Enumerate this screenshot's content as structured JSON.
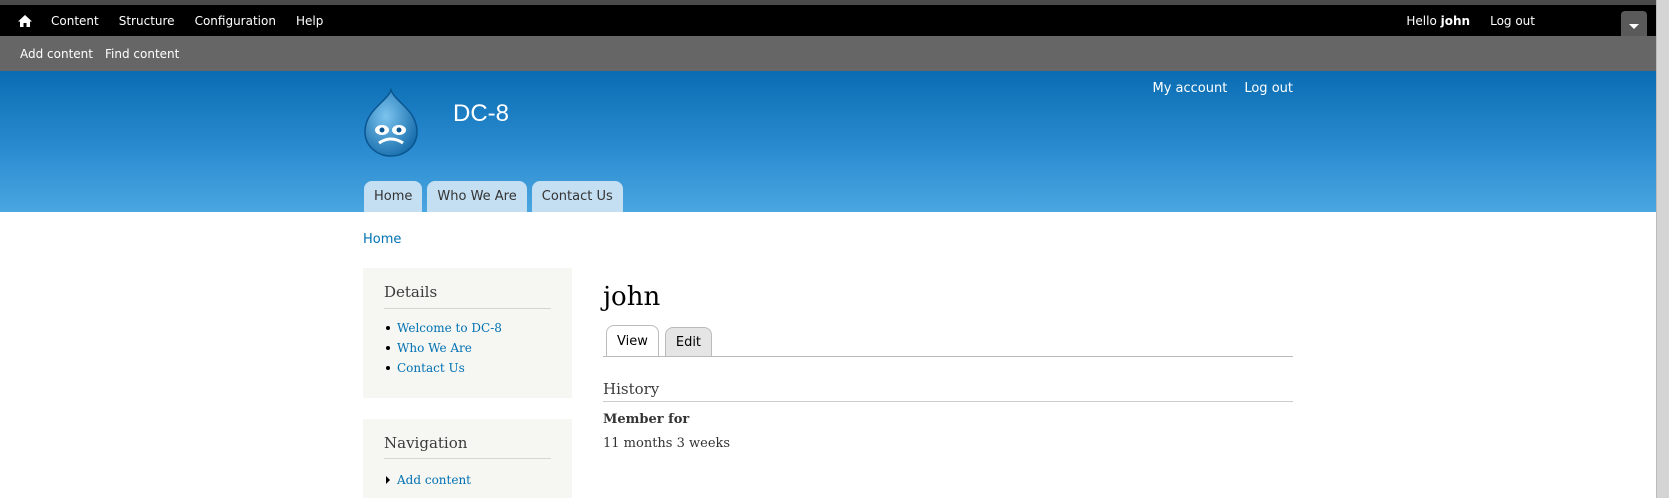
{
  "toolbar": {
    "menu": [
      "Content",
      "Structure",
      "Configuration",
      "Help"
    ],
    "hello_prefix": "Hello",
    "username": "john",
    "logout": "Log out"
  },
  "shortcuts": [
    "Add content",
    "Find content"
  ],
  "header": {
    "site_name": "DC-8",
    "secondary_menu": [
      "My account",
      "Log out"
    ],
    "main_tabs": [
      "Home",
      "Who We Are",
      "Contact Us"
    ],
    "colors": {
      "gradient_top": "#0a6cb2",
      "gradient_bottom": "#4aa6e0"
    }
  },
  "breadcrumb": "Home",
  "sidebar": {
    "details": {
      "title": "Details",
      "items": [
        "Welcome to DC-8",
        "Who We Are",
        "Contact Us"
      ]
    },
    "navigation": {
      "title": "Navigation",
      "items": [
        "Add content"
      ]
    }
  },
  "main": {
    "title": "john",
    "tabs": [
      "View",
      "Edit"
    ],
    "active_tab": "View",
    "section": "History",
    "member_label": "Member for",
    "member_value": "11 months 3 weeks"
  },
  "icons": [
    "home-icon",
    "drupal-logo",
    "toolbar-toggle-icon"
  ],
  "link_color": "#0071b3"
}
